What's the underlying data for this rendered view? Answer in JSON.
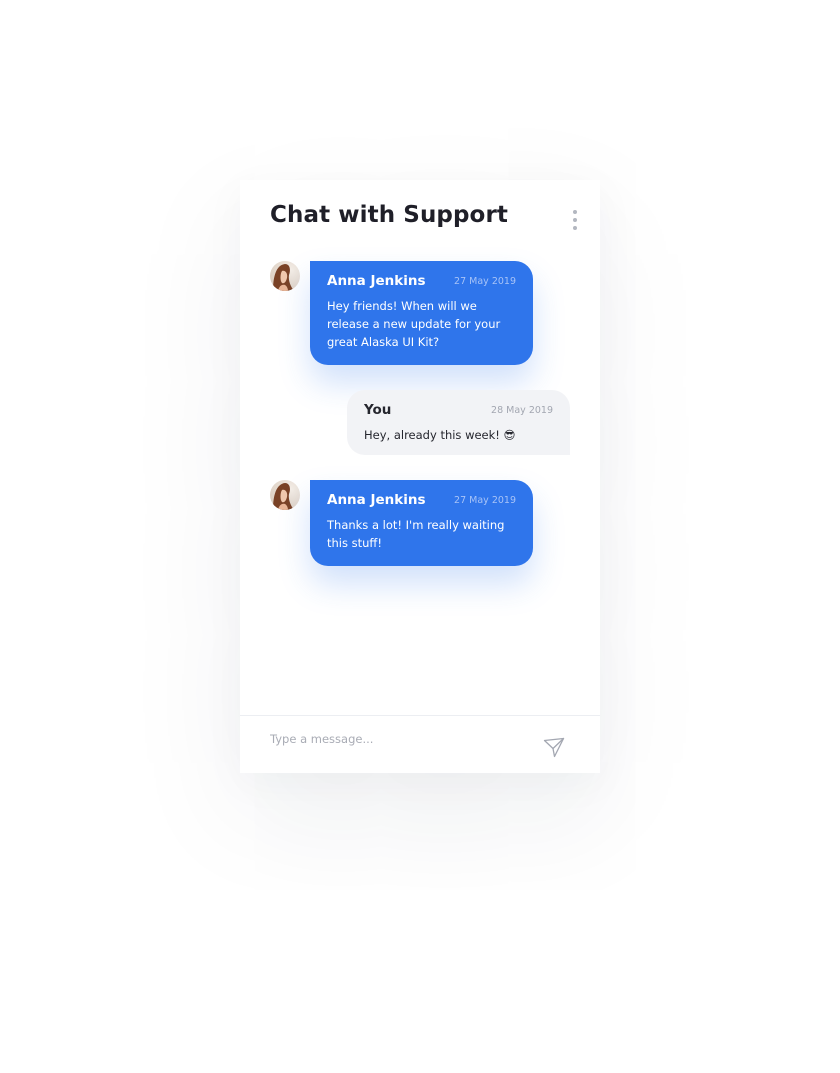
{
  "chat": {
    "title": "Chat with Support",
    "menu_icon": "more-vertical-icon",
    "messages": [
      {
        "direction": "incoming",
        "sender": "Anna Jenkins",
        "date": "27 May 2019",
        "text": "Hey friends! When will we release a new update for your great Alaska UI Kit?",
        "avatar_icon": "user-avatar-photo"
      },
      {
        "direction": "outgoing",
        "sender": "You",
        "date": "28 May 2019",
        "text": "Hey, already this week! 😎"
      },
      {
        "direction": "incoming",
        "sender": "Anna Jenkins",
        "date": "27 May 2019",
        "text": "Thanks a lot! I'm really waiting this stuff!",
        "avatar_icon": "user-avatar-photo"
      }
    ]
  },
  "composer": {
    "placeholder": "Type a message...",
    "send_icon": "paper-plane-icon"
  },
  "colors": {
    "accent": "#2f75eb",
    "outgoing_bubble": "#f2f3f6",
    "title": "#1f1f28"
  }
}
